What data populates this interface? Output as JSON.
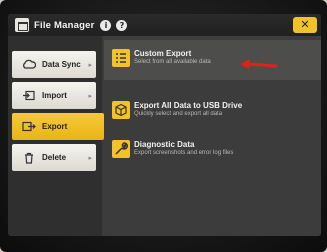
{
  "window": {
    "title": "File Manager",
    "info_glyph": "i",
    "help_glyph": "?",
    "close_glyph": "✕"
  },
  "sidebar": {
    "items": [
      {
        "label": "Data Sync",
        "icon": "cloud-sync-icon"
      },
      {
        "label": "Import",
        "icon": "import-icon"
      },
      {
        "label": "Export",
        "icon": "export-icon",
        "active": true
      },
      {
        "label": "Delete",
        "icon": "trash-icon"
      }
    ]
  },
  "main": {
    "options": [
      {
        "title": "Custom Export",
        "subtitle": "Select from all available data",
        "icon": "checklist-icon",
        "highlighted": true
      },
      {
        "title": "Export All Data to USB Drive",
        "subtitle": "Quickly select and export all data",
        "icon": "usb-export-icon"
      },
      {
        "title": "Diagnostic Data",
        "subtitle": "Export screenshots and error log files",
        "icon": "wrench-icon"
      }
    ]
  },
  "colors": {
    "accent": "#f2c22c",
    "annotation_arrow": "#e0201b",
    "background": "#3b3c3b"
  }
}
